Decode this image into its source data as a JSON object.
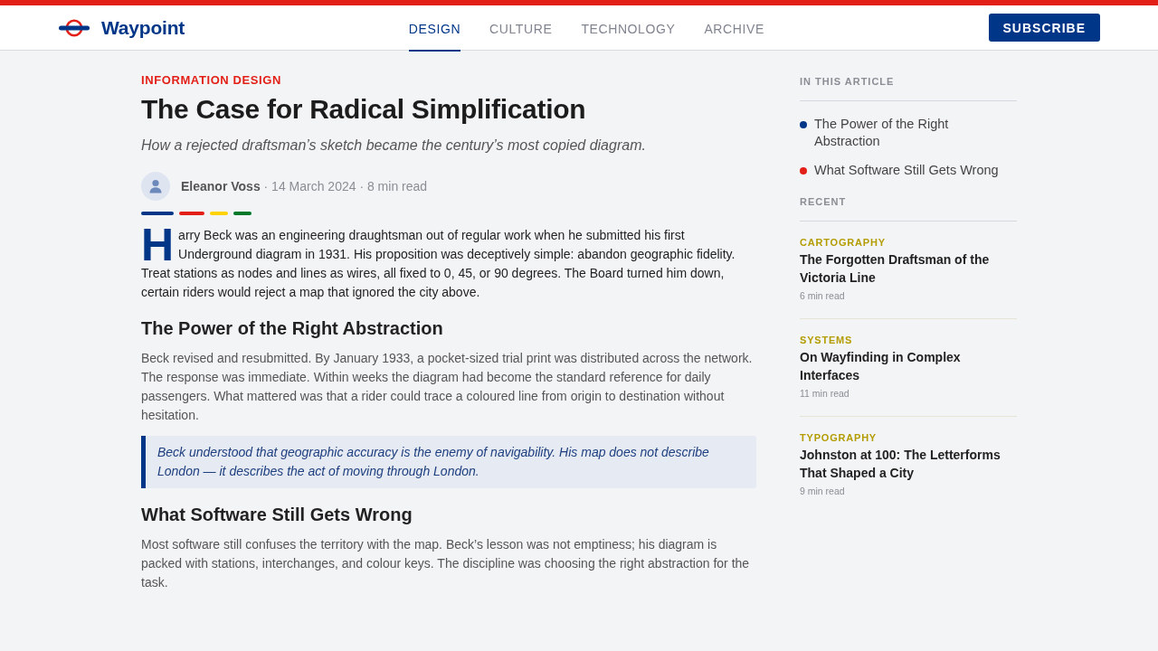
{
  "header": {
    "brand": "Waypoint",
    "nav": [
      {
        "label": "DESIGN",
        "selected": true
      },
      {
        "label": "CULTURE",
        "selected": false
      },
      {
        "label": "TECHNOLOGY",
        "selected": false
      },
      {
        "label": "ARCHIVE",
        "selected": false
      }
    ],
    "subscribe_button": "SUBSCRIBE"
  },
  "article": {
    "category": "INFORMATION DESIGN",
    "title": "The Case for Radical Simplification",
    "subtitle": "How a rejected draftsman’s sketch became the century’s most copied diagram.",
    "byline": "**Eleanor Voss** · 14 March 2024 · 8 min read",
    "line_colors": [
      {
        "color": "#003688"
      },
      {
        "color": "#e32017"
      },
      {
        "color": "#ffd300"
      },
      {
        "color": "#00782a"
      }
    ],
    "body": [
      {
        "kind": "lead",
        "text": "Harry Beck was an engineering draughtsman out of regular work when he submitted his first Underground diagram in 1931. His proposition was deceptively simple: abandon geographic fidelity. Treat stations as nodes and lines as wires, all fixed to 0, 45, or 90 degrees. The Board turned him down, certain riders would reject a map that ignored the city above."
      },
      {
        "kind": "heading",
        "text": "The Power of the Right Abstraction"
      },
      {
        "kind": "paragraph",
        "text": "Beck revised and resubmitted. By January 1933, a pocket-sized trial print was distributed across the network. The response was immediate. Within weeks the diagram had become the standard reference for daily passengers. What mattered was that a rider could trace a coloured line from origin to destination without hesitation."
      },
      {
        "kind": "pullquote",
        "text": "Beck understood that geographic accuracy is the enemy of navigability. His map does not describe London — it describes the act of moving through London."
      },
      {
        "kind": "heading",
        "text": "What Software Still Gets Wrong"
      },
      {
        "kind": "paragraph",
        "text": "Most software still confuses the territory with the map. Beck’s lesson was not emptiness; his diagram is packed with stations, interchanges, and colour keys. The discipline was choosing the right abstraction for the task."
      }
    ]
  },
  "sidebar": {
    "toc_heading": "IN THIS ARTICLE",
    "toc": [
      {
        "label": "The Power of the Right Abstraction",
        "color": "#003688"
      },
      {
        "label": "What Software Still Gets Wrong",
        "color": "#e32017"
      }
    ],
    "recent_heading": "RECENT",
    "recent": [
      {
        "category": "CARTOGRAPHY",
        "title": "The Forgotten Draftsman of the Victoria Line",
        "read_time": "6 min read"
      },
      {
        "category": "SYSTEMS",
        "title": "On Wayfinding in Complex Interfaces",
        "read_time": "11 min read"
      },
      {
        "category": "TYPOGRAPHY",
        "title": "Johnston at 100: The Letterforms That Shaped a City",
        "read_time": "9 min read"
      }
    ]
  }
}
